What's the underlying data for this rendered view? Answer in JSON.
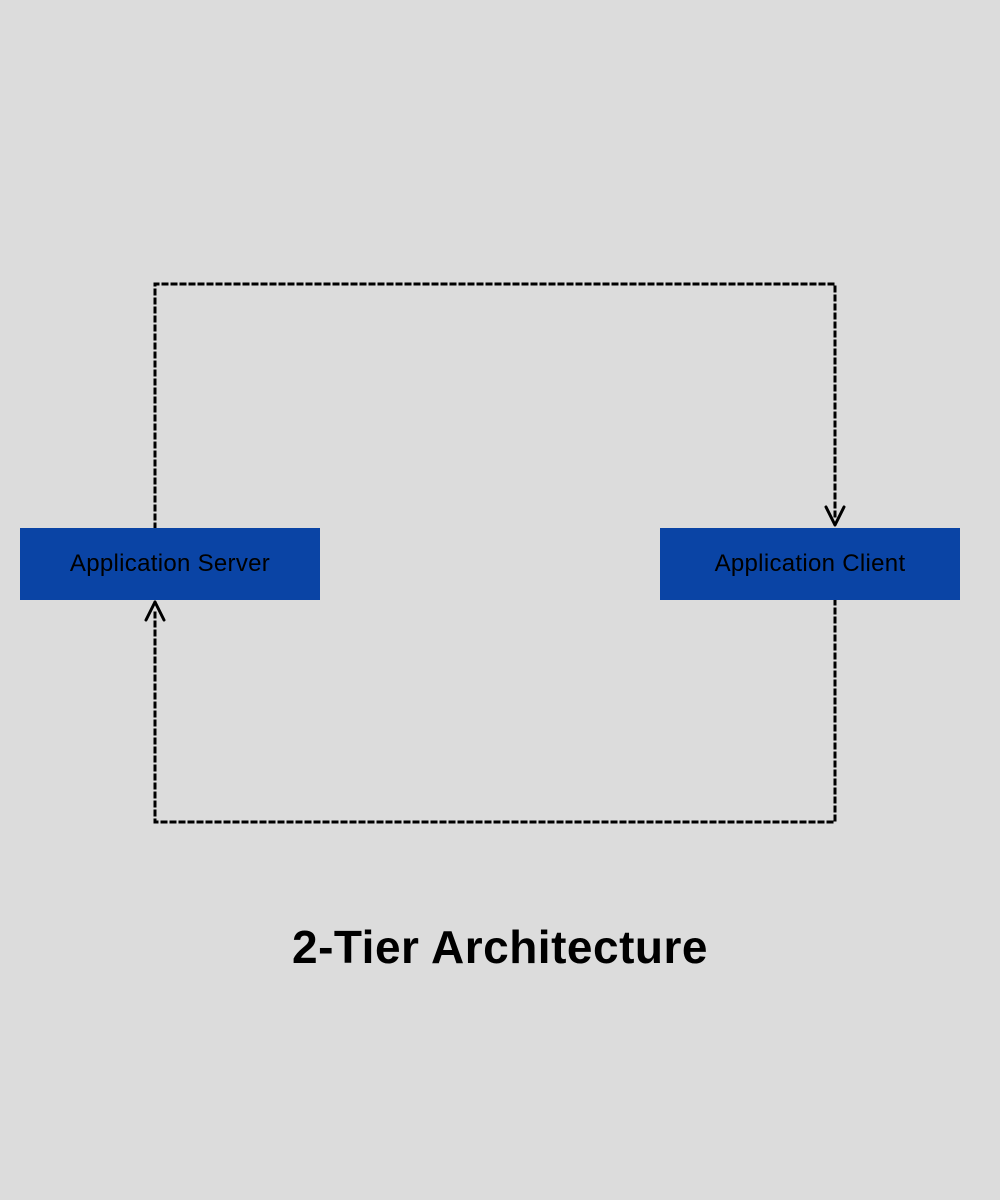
{
  "diagram": {
    "title": "2-Tier Architecture",
    "server_label": "Application Server",
    "client_label": "Application Client"
  },
  "colors": {
    "box_fill": "#0a44a5",
    "background": "#dcdcdc",
    "stroke": "#000000"
  }
}
